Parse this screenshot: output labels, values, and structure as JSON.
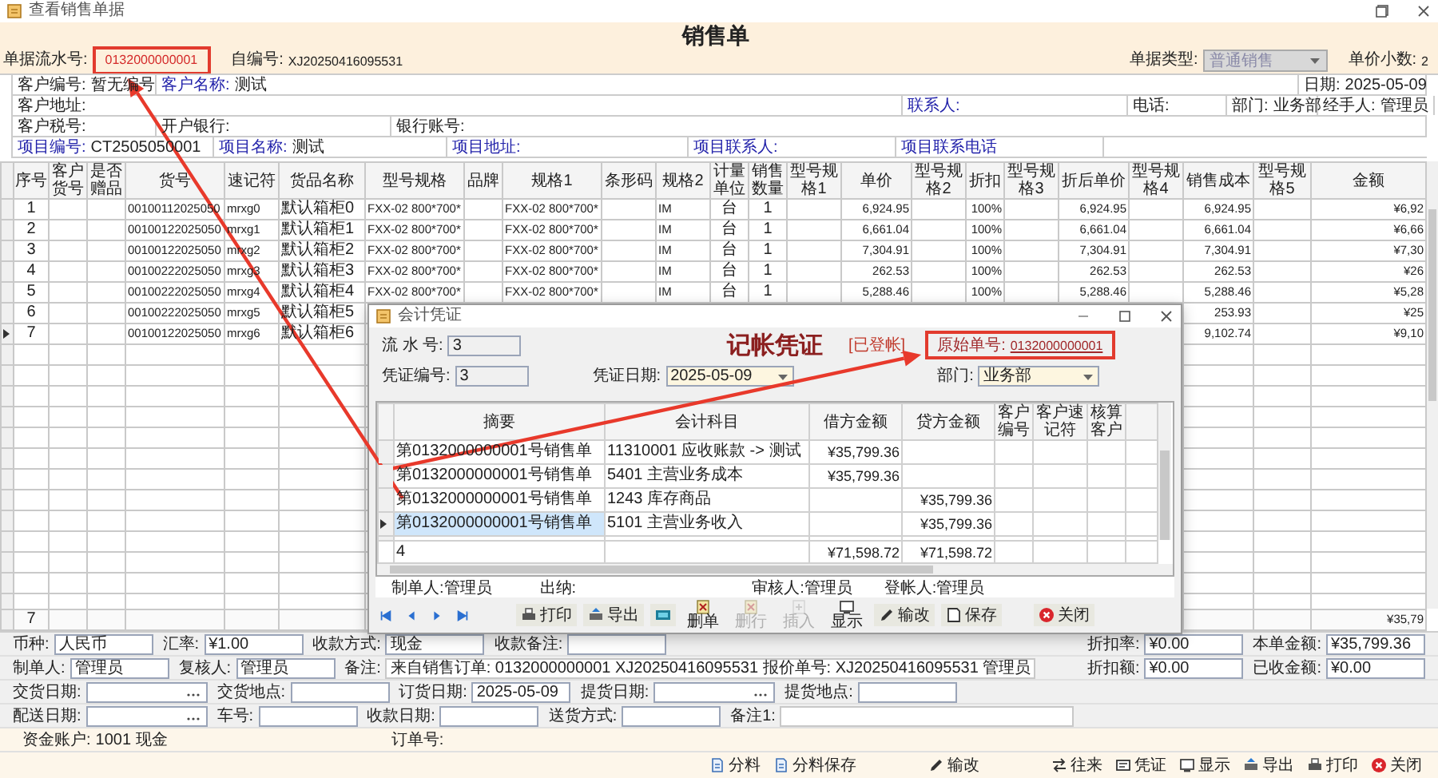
{
  "window": {
    "title": "查看销售单据"
  },
  "header": {
    "title": "销售单",
    "serial_label": "单据流水号:",
    "serial": "0132000000001",
    "serial_highlighted": true,
    "own_no_label": "自编号:",
    "own_no": "XJ20250416095531",
    "type_label": "单据类型:",
    "type_value": "普通销售",
    "type_disabled": true,
    "decimals_label": "单价小数:",
    "decimals": "2"
  },
  "form_rows": [
    [
      {
        "label": "客户编号:",
        "value": "暂无编号",
        "link": false
      },
      {
        "label": "客户名称:",
        "value": "测试",
        "link": true
      },
      {
        "label": "日期:",
        "value": "2025-05-09",
        "link": false
      }
    ],
    [
      {
        "label": "客户地址:",
        "link": false
      },
      {
        "label": "联系人:",
        "link": true
      },
      {
        "label": "电话:",
        "link": false
      },
      {
        "label": "部门:",
        "value": "业务部",
        "link": false
      },
      {
        "label": "经手人:",
        "value": "管理员",
        "link": false
      }
    ],
    [
      {
        "label": "客户税号:",
        "link": false
      },
      {
        "label": "开户银行:",
        "link": false
      },
      {
        "label": "银行账号:",
        "link": false
      }
    ],
    [
      {
        "label": "项目编号:",
        "value": "CT2505050001",
        "link": true
      },
      {
        "label": "项目名称:",
        "value": "测试",
        "link": true
      },
      {
        "label": "项目地址:",
        "link": true
      },
      {
        "label": "项目联系人:",
        "link": true
      },
      {
        "label": "项目联系电话",
        "link": true
      }
    ]
  ],
  "table": {
    "columns": [
      {
        "label": "序号",
        "kind": "center"
      },
      {
        "label": "客户货号",
        "kind": "text"
      },
      {
        "label": "是否赠品",
        "kind": "center"
      },
      {
        "label": "货号",
        "kind": "code"
      },
      {
        "label": "速记符",
        "kind": "code"
      },
      {
        "label": "货品名称",
        "kind": "text"
      },
      {
        "label": "型号规格",
        "kind": "code"
      },
      {
        "label": "品牌",
        "kind": "text"
      },
      {
        "label": "规格1",
        "kind": "code"
      },
      {
        "label": "条形码",
        "kind": "code"
      },
      {
        "label": "规格2",
        "kind": "code"
      },
      {
        "label": "计量单位",
        "kind": "center"
      },
      {
        "label": "销售数量",
        "kind": "center"
      },
      {
        "label": "型号规格1",
        "kind": "text"
      },
      {
        "label": "单价",
        "kind": "number"
      },
      {
        "label": "型号规格2",
        "kind": "text"
      },
      {
        "label": "折扣",
        "kind": "number"
      },
      {
        "label": "型号规格3",
        "kind": "text"
      },
      {
        "label": "折后单价",
        "kind": "number"
      },
      {
        "label": "型号规格4",
        "kind": "text"
      },
      {
        "label": "销售成本",
        "kind": "number"
      },
      {
        "label": "型号规格5",
        "kind": "text"
      },
      {
        "label": "金额",
        "kind": "number"
      }
    ],
    "rows": [
      {
        "current": false,
        "cells": [
          "1",
          null,
          null,
          "00100112025050",
          "mrxg0",
          "默认箱柜0",
          "FXX-02 800*700*",
          null,
          "FXX-02 800*700*",
          null,
          "IM",
          "台",
          "1",
          null,
          "6,924.95",
          null,
          "100%",
          null,
          "6,924.95",
          null,
          "6,924.95",
          null,
          "¥6,92"
        ]
      },
      {
        "current": false,
        "cells": [
          "2",
          null,
          null,
          "00100122025050",
          "mrxg1",
          "默认箱柜1",
          "FXX-02 800*700*",
          null,
          "FXX-02 800*700*",
          null,
          "IM",
          "台",
          "1",
          null,
          "6,661.04",
          null,
          "100%",
          null,
          "6,661.04",
          null,
          "6,661.04",
          null,
          "¥6,66"
        ]
      },
      {
        "current": false,
        "cells": [
          "3",
          null,
          null,
          "00100122025050",
          "mrxg2",
          "默认箱柜2",
          "FXX-02 800*700*",
          null,
          "FXX-02 800*700*",
          null,
          "IM",
          "台",
          "1",
          null,
          "7,304.91",
          null,
          "100%",
          null,
          "7,304.91",
          null,
          "7,304.91",
          null,
          "¥7,30"
        ]
      },
      {
        "current": false,
        "cells": [
          "4",
          null,
          null,
          "00100222025050",
          "mrxg3",
          "默认箱柜3",
          "FXX-02 800*700*",
          null,
          "FXX-02 800*700*",
          null,
          "IM",
          "台",
          "1",
          null,
          "262.53",
          null,
          "100%",
          null,
          "262.53",
          null,
          "262.53",
          null,
          "¥26"
        ]
      },
      {
        "current": false,
        "cells": [
          "5",
          null,
          null,
          "00100222025050",
          "mrxg4",
          "默认箱柜4",
          "FXX-02 800*700*",
          null,
          "FXX-02 800*700*",
          null,
          "IM",
          "台",
          "1",
          null,
          "5,288.46",
          null,
          "100%",
          null,
          "5,288.46",
          null,
          "5,288.46",
          null,
          "¥5,28"
        ]
      },
      {
        "current": false,
        "cells": [
          "6",
          null,
          null,
          "00100222025050",
          "mrxg5",
          "默认箱柜5",
          null,
          null,
          null,
          null,
          null,
          null,
          null,
          null,
          null,
          null,
          null,
          null,
          null,
          null,
          "253.93",
          null,
          "¥25"
        ]
      },
      {
        "current": true,
        "cells": [
          "7",
          null,
          null,
          "00100122025050",
          "mrxg6",
          "默认箱柜6",
          null,
          null,
          null,
          null,
          null,
          null,
          null,
          null,
          null,
          null,
          null,
          null,
          null,
          null,
          "9,102.74",
          null,
          "¥9,10"
        ]
      }
    ],
    "totals": {
      "count": "7",
      "amount": "¥35,79"
    }
  },
  "voucher": {
    "title": "会计凭证",
    "heading": "记帐凭证",
    "status": "[已登帐]",
    "source_label": "原始单号:",
    "source_no": "0132000000001",
    "source_highlighted": true,
    "fields": [
      {
        "label": "流 水 号:",
        "value": "3",
        "kind": "input"
      },
      {
        "label": "凭证编号:",
        "value": "3",
        "kind": "input"
      },
      {
        "label": "凭证日期:",
        "value": "2025-05-09",
        "kind": "date"
      },
      {
        "label": "部门:",
        "value": "业务部",
        "kind": "dropdown"
      }
    ],
    "columns": [
      "摘要",
      "会计科目",
      "借方金额",
      "贷方金额",
      "客户编号",
      "客户速记符",
      "核算客户"
    ],
    "rows": [
      {
        "summary": "第0132000000001号销售单",
        "account": "11310001 应收账款 -> 测试",
        "debit": "¥35,799.36",
        "selected": false
      },
      {
        "summary": "第0132000000001号销售单",
        "account": "5401 主营业务成本",
        "debit": "¥35,799.36",
        "selected": false
      },
      {
        "summary": "第0132000000001号销售单",
        "account": "1243 库存商品",
        "credit": "¥35,799.36",
        "selected": false
      },
      {
        "summary": "第0132000000001号销售单",
        "account": "5101 主营业务收入",
        "credit": "¥35,799.36",
        "selected": true
      }
    ],
    "totals": {
      "count": "4",
      "debit": "¥71,598.72",
      "credit": "¥71,598.72"
    },
    "signatures": [
      "制单人:管理员",
      "出纳:",
      "审核人:管理员",
      "登帐人:管理员"
    ],
    "toolbar": [
      {
        "label": "打印",
        "kind": "inline",
        "disabled": false
      },
      {
        "label": "导出",
        "kind": "inline",
        "disabled": false
      },
      {
        "kind": "inline",
        "disabled": false
      },
      {
        "label": "删单",
        "kind": "stacked",
        "disabled": false
      },
      {
        "label": "删行",
        "kind": "stacked",
        "disabled": true
      },
      {
        "label": "插入",
        "kind": "stacked",
        "disabled": true
      },
      {
        "label": "显示",
        "kind": "stacked",
        "disabled": false
      },
      {
        "label": "输改",
        "kind": "inline",
        "disabled": false
      },
      {
        "label": "保存",
        "kind": "inline",
        "disabled": false
      },
      {
        "label": "关闭",
        "kind": "inline",
        "disabled": false
      }
    ]
  },
  "footer_rows": [
    {
      "left": [
        {
          "label": "币种:",
          "value": "人民币",
          "kind": "input"
        },
        {
          "label": "汇率:",
          "value": "¥1.00",
          "kind": "input"
        },
        {
          "label": "收款方式:",
          "value": "现金",
          "kind": "input"
        },
        {
          "label": "收款备注:",
          "kind": "input"
        }
      ],
      "right": [
        {
          "label": "折扣率:",
          "value": "¥0.00",
          "kind": "input"
        },
        {
          "label": "本单金额:",
          "value": "¥35,799.36",
          "kind": "input"
        }
      ]
    },
    {
      "left": [
        {
          "label": "制单人:",
          "value": "管理员",
          "kind": "input"
        },
        {
          "label": "复核人:",
          "value": "管理员",
          "kind": "input"
        },
        {
          "label": "备注:",
          "value": "来自销售订单: 0132000000001 XJ20250416095531 报价单号: XJ20250416095531 管理员",
          "kind": "wide"
        }
      ],
      "right": [
        {
          "label": "折扣额:",
          "value": "¥0.00",
          "kind": "input"
        },
        {
          "label": "已收金额:",
          "value": "¥0.00",
          "kind": "input"
        }
      ]
    },
    {
      "left": [
        {
          "label": "交货日期:",
          "kind": "dropdown"
        },
        {
          "label": "交货地点:",
          "kind": "input"
        },
        {
          "label": "订货日期:",
          "value": "2025-05-09",
          "kind": "input"
        },
        {
          "label": "提货日期:",
          "kind": "dropdown"
        },
        {
          "label": "提货地点:",
          "kind": "input"
        }
      ]
    },
    {
      "left": [
        {
          "label": "配送日期:",
          "kind": "dropdown"
        },
        {
          "label": "车号:",
          "kind": "input"
        },
        {
          "label": "收款日期:",
          "kind": "input"
        },
        {
          "label": "送货方式:",
          "kind": "input"
        },
        {
          "label": "备注1:",
          "kind": "wide"
        }
      ]
    },
    {
      "left": [
        {
          "label": "资金账户:",
          "value": "1001 现金",
          "kind": "plain"
        },
        {
          "label": "订单号:",
          "kind": "plain"
        }
      ]
    }
  ],
  "toolbar": [
    {
      "label": "分料"
    },
    {
      "label": "分料保存"
    },
    {
      "label": "输改"
    },
    {
      "label": "往来"
    },
    {
      "label": "凭证"
    },
    {
      "label": "显示"
    },
    {
      "label": "导出"
    },
    {
      "label": "打印"
    },
    {
      "label": "关闭"
    }
  ]
}
